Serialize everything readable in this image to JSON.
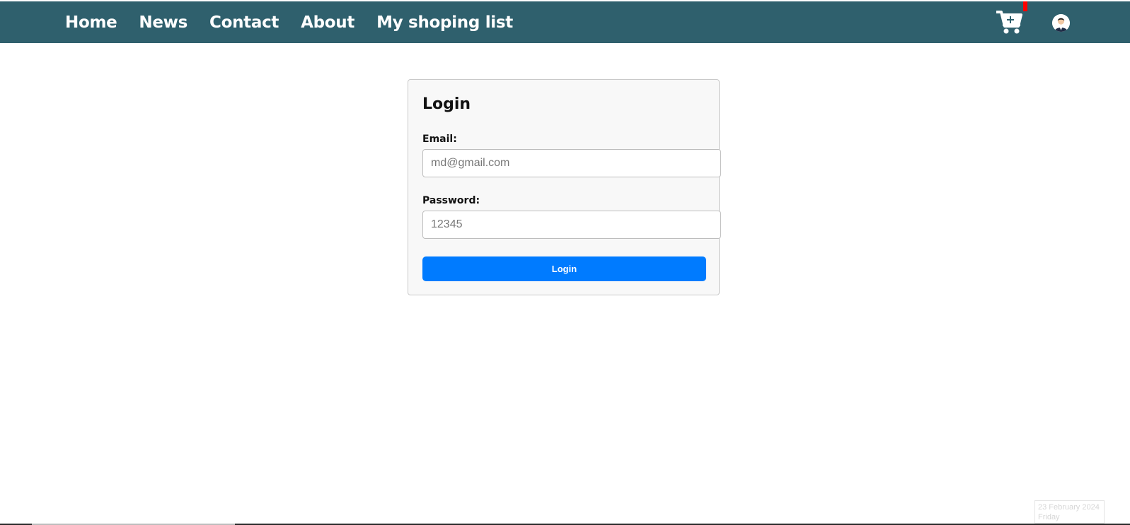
{
  "nav": {
    "items": [
      {
        "label": "Home"
      },
      {
        "label": "News"
      },
      {
        "label": "Contact"
      },
      {
        "label": "About"
      },
      {
        "label": "My shoping list"
      }
    ],
    "cart_icon": "cart-plus-icon",
    "avatar_icon": "user-avatar-icon"
  },
  "login": {
    "title": "Login",
    "email_label": "Email:",
    "email_placeholder": "md@gmail.com",
    "password_label": "Password:",
    "password_placeholder": "12345",
    "submit_label": "Login"
  },
  "date_widget": {
    "date": "23 February 2024",
    "day": "Friday"
  },
  "colors": {
    "navbar": "#2f606d",
    "button": "#007bff",
    "badge": "#ff0000"
  }
}
